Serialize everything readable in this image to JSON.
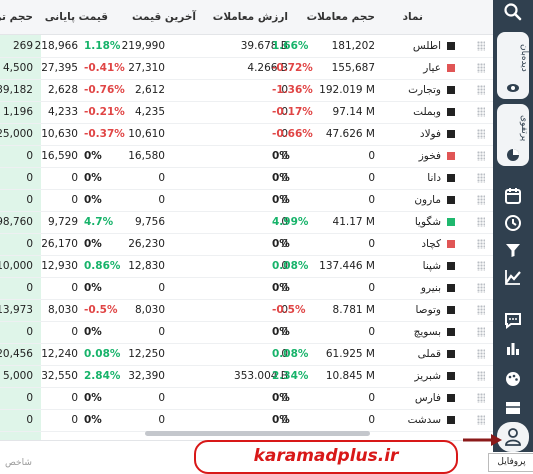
{
  "columns": {
    "symbol": "نماد",
    "volume": "حجم معاملات",
    "value": "ارزش معاملات",
    "last_price": "آخرین قیمت",
    "close_price": "قیمت پایانی",
    "volume_short": "حجم تر"
  },
  "rows": [
    {
      "symbol": "اطلس",
      "mark": "#222222",
      "volume": "181,202",
      "value": "39.678 B",
      "last": "219,990",
      "last_pct": "1.66%",
      "last_dir": "pos",
      "close": "218,966",
      "close_pct": "1.18%",
      "close_dir": "pos",
      "vol2": "269"
    },
    {
      "symbol": "عیار",
      "mark": "#e05555",
      "volume": "155,687",
      "value": "4.266 B",
      "last": "27,310",
      "last_pct": "-0.72%",
      "last_dir": "neg",
      "close": "27,395",
      "close_pct": "-0.41%",
      "close_dir": "neg",
      "vol2": "4,500"
    },
    {
      "symbol": "وتجارت",
      "mark": "#222222",
      "volume": "192.019 M",
      "value": "0",
      "last": "2,612",
      "last_pct": "-1.36%",
      "last_dir": "neg",
      "close": "2,628",
      "close_pct": "-0.76%",
      "close_dir": "neg",
      "vol2": "39,182"
    },
    {
      "symbol": "وبملت",
      "mark": "#222222",
      "volume": "97.14 M",
      "value": "0",
      "last": "4,235",
      "last_pct": "-0.17%",
      "last_dir": "neg",
      "close": "4,233",
      "close_pct": "-0.21%",
      "close_dir": "neg",
      "vol2": "1,196"
    },
    {
      "symbol": "فولاد",
      "mark": "#222222",
      "volume": "47.626 M",
      "value": "0",
      "last": "10,610",
      "last_pct": "-0.66%",
      "last_dir": "neg",
      "close": "10,630",
      "close_pct": "-0.37%",
      "close_dir": "neg",
      "vol2": "25,000"
    },
    {
      "symbol": "فخوز",
      "mark": "#e05555",
      "volume": "0",
      "value": "0",
      "last": "16,580",
      "last_pct": "0%",
      "last_dir": "zer",
      "close": "16,590",
      "close_pct": "0%",
      "close_dir": "zer",
      "vol2": "0"
    },
    {
      "symbol": "دانا",
      "mark": "#222222",
      "volume": "0",
      "value": "0",
      "last": "0",
      "last_pct": "0%",
      "last_dir": "zer",
      "close": "0",
      "close_pct": "0%",
      "close_dir": "zer",
      "vol2": "0"
    },
    {
      "symbol": "مارون",
      "mark": "#222222",
      "volume": "0",
      "value": "0",
      "last": "0",
      "last_pct": "0%",
      "last_dir": "zer",
      "close": "0",
      "close_pct": "0%",
      "close_dir": "zer",
      "vol2": "0"
    },
    {
      "symbol": "شگویا",
      "mark": "#1fb86e",
      "volume": "41.17 M",
      "value": "0",
      "last": "9,756",
      "last_pct": "4.99%",
      "last_dir": "pos",
      "close": "9,729",
      "close_pct": "4.7%",
      "close_dir": "pos",
      "vol2": "98,760"
    },
    {
      "symbol": "کچاد",
      "mark": "#e05555",
      "volume": "0",
      "value": "0",
      "last": "26,230",
      "last_pct": "0%",
      "last_dir": "zer",
      "close": "26,170",
      "close_pct": "0%",
      "close_dir": "zer",
      "vol2": "0"
    },
    {
      "symbol": "شپنا",
      "mark": "#222222",
      "volume": "137.446 M",
      "value": "0",
      "last": "12,830",
      "last_pct": "0.08%",
      "last_dir": "pos",
      "close": "12,930",
      "close_pct": "0.86%",
      "close_dir": "pos",
      "vol2": "10,000"
    },
    {
      "symbol": "بنیرو",
      "mark": "#222222",
      "volume": "0",
      "value": "0",
      "last": "0",
      "last_pct": "0%",
      "last_dir": "zer",
      "close": "0",
      "close_pct": "0%",
      "close_dir": "zer",
      "vol2": "0"
    },
    {
      "symbol": "وتوصا",
      "mark": "#222222",
      "volume": "8.781 M",
      "value": "0",
      "last": "8,030",
      "last_pct": "-0.5%",
      "last_dir": "neg",
      "close": "8,030",
      "close_pct": "-0.5%",
      "close_dir": "neg",
      "vol2": "13,973"
    },
    {
      "symbol": "بسویچ",
      "mark": "#222222",
      "volume": "0",
      "value": "0",
      "last": "0",
      "last_pct": "0%",
      "last_dir": "zer",
      "close": "0",
      "close_pct": "0%",
      "close_dir": "zer",
      "vol2": "0"
    },
    {
      "symbol": "قملی",
      "mark": "#222222",
      "volume": "61.925 M",
      "value": "0",
      "last": "12,250",
      "last_pct": "0.08%",
      "last_dir": "pos",
      "close": "12,240",
      "close_pct": "0.08%",
      "close_dir": "pos",
      "vol2": "20,456"
    },
    {
      "symbol": "شبریز",
      "mark": "#222222",
      "volume": "10.845 M",
      "value": "353.004 B",
      "last": "32,390",
      "last_pct": "2.34%",
      "last_dir": "pos",
      "close": "32,550",
      "close_pct": "2.84%",
      "close_dir": "pos",
      "vol2": "5,000"
    },
    {
      "symbol": "فارس",
      "mark": "#222222",
      "volume": "0",
      "value": "0",
      "last": "0",
      "last_pct": "0%",
      "last_dir": "zer",
      "close": "0",
      "close_pct": "0%",
      "close_dir": "zer",
      "vol2": "0"
    },
    {
      "symbol": "سدشت",
      "mark": "#222222",
      "volume": "0",
      "value": "0",
      "last": "0",
      "last_pct": "0%",
      "last_dir": "zer",
      "close": "0",
      "close_pct": "0%",
      "close_dir": "zer",
      "vol2": "0"
    }
  ],
  "rail": {
    "watchlist_label": "دیده‌بان",
    "portfolio_label": "پرتفوی",
    "icons": [
      "search-icon",
      "eye-icon",
      "pie-chart-icon",
      "calendar-icon",
      "history-icon",
      "filter-icon",
      "line-chart-icon",
      "message-icon",
      "bar-chart-icon",
      "palette-icon",
      "layout-icon",
      "profile-icon"
    ]
  },
  "tooltip": "پروفایل",
  "bottom_text": "شاخص",
  "watermark": "karamadplus.ir",
  "colors": {
    "positive": "#17b36a",
    "negative": "#e04545",
    "rail": "#30404f",
    "highlight": "#dff5e9",
    "watermark": "#d81818"
  }
}
